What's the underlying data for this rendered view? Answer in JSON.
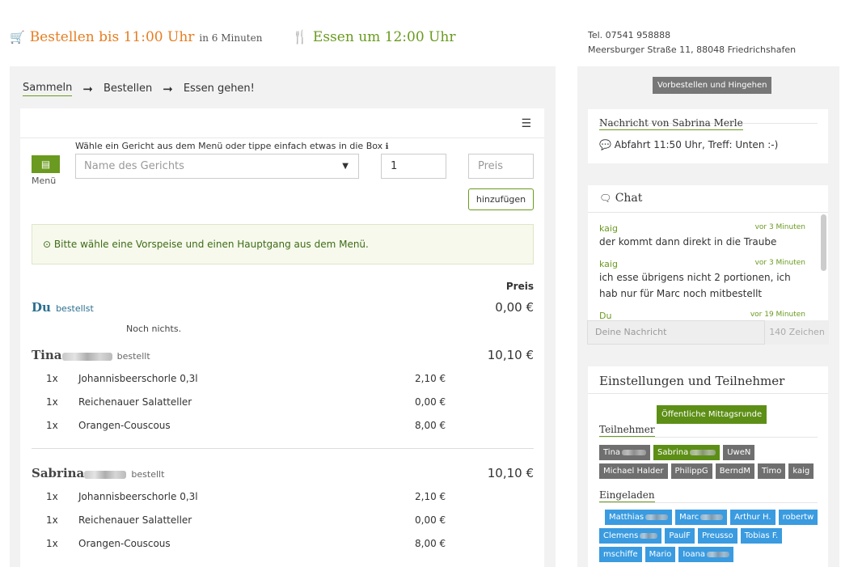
{
  "header": {
    "order_until": "Bestellen bis 11:00 Uhr",
    "order_in": "in 6 Minuten",
    "eat_at": "Essen um 12:00 Uhr",
    "phone": "Tel. 07541 958888",
    "address": "Meersburger Straße 11, 88048 Friedrichshafen",
    "colors": {
      "accent_orange": "#e67e22",
      "accent_green": "#6a9a1f"
    }
  },
  "steps": [
    "Sammeln",
    "Bestellen",
    "Essen gehen!"
  ],
  "form": {
    "hint": "Wähle ein Gericht aus dem Menü oder tippe einfach etwas in die Box",
    "menu_label": "Menü",
    "dish_placeholder": "Name des Gerichts",
    "quantity": "1",
    "price_placeholder": "Preis",
    "add_button": "hinzufügen"
  },
  "notice": "Bitte wähle eine Vorspeise und einen Hauptgang aus dem Menü.",
  "orders": {
    "price_header": "Preis",
    "you": {
      "name": "Du",
      "verb": "bestellst",
      "total": "0,00 €",
      "empty": "Noch nichts."
    },
    "people": [
      {
        "name": "Tina",
        "verb": "bestellt",
        "total": "10,10 €",
        "items": [
          {
            "qty": "1x",
            "name": "Johannisbeerschorle 0,3l",
            "price": "2,10 €"
          },
          {
            "qty": "1x",
            "name": "Reichenauer Salatteller",
            "price": "0,00 €"
          },
          {
            "qty": "1x",
            "name": "Orangen-Couscous",
            "price": "8,00 €"
          }
        ]
      },
      {
        "name": "Sabrina",
        "verb": "bestellt",
        "total": "10,10 €",
        "items": [
          {
            "qty": "1x",
            "name": "Johannisbeerschorle 0,3l",
            "price": "2,10 €"
          },
          {
            "qty": "1x",
            "name": "Reichenauer Salatteller",
            "price": "0,00 €"
          },
          {
            "qty": "1x",
            "name": "Orangen-Couscous",
            "price": "8,00 €"
          }
        ]
      }
    ]
  },
  "sidebar": {
    "preorder_button": "Vorbestellen und Hingehen",
    "message_title": "Nachricht von Sabrina Merle",
    "message_text": "Abfahrt 11:50 Uhr, Treff: Unten :-)",
    "chat": {
      "title": "Chat",
      "messages": [
        {
          "author": "kaig",
          "time": "vor 3 Minuten",
          "text": "der kommt dann direkt in die Traube"
        },
        {
          "author": "kaig",
          "time": "vor 3 Minuten",
          "text": "ich esse übrigens nicht 2 portionen, ich hab nur für Marc noch mitbestellt"
        },
        {
          "author": "Du",
          "time": "vor 19 Minuten",
          "text": ""
        }
      ],
      "input_placeholder": "Deine Nachricht",
      "char_count": "140 Zeichen"
    },
    "settings": {
      "title": "Einstellungen und Teilnehmer",
      "public_button": "Öffentliche Mittagsrunde",
      "participants_title": "Teilnehmer",
      "participants": [
        "Tina",
        "Sabrina",
        "UweN",
        "Michael Halder",
        "PhilippG",
        "BerndM",
        "Timo",
        "kaig"
      ],
      "invited_title": "Eingeladen",
      "invited": [
        "Matthias",
        "Marc",
        "Arthur H.",
        "robertw",
        "Clemens",
        "PaulF",
        "Preusso",
        "Tobias F.",
        "mschiffe",
        "Mario",
        "Ioana"
      ]
    }
  }
}
